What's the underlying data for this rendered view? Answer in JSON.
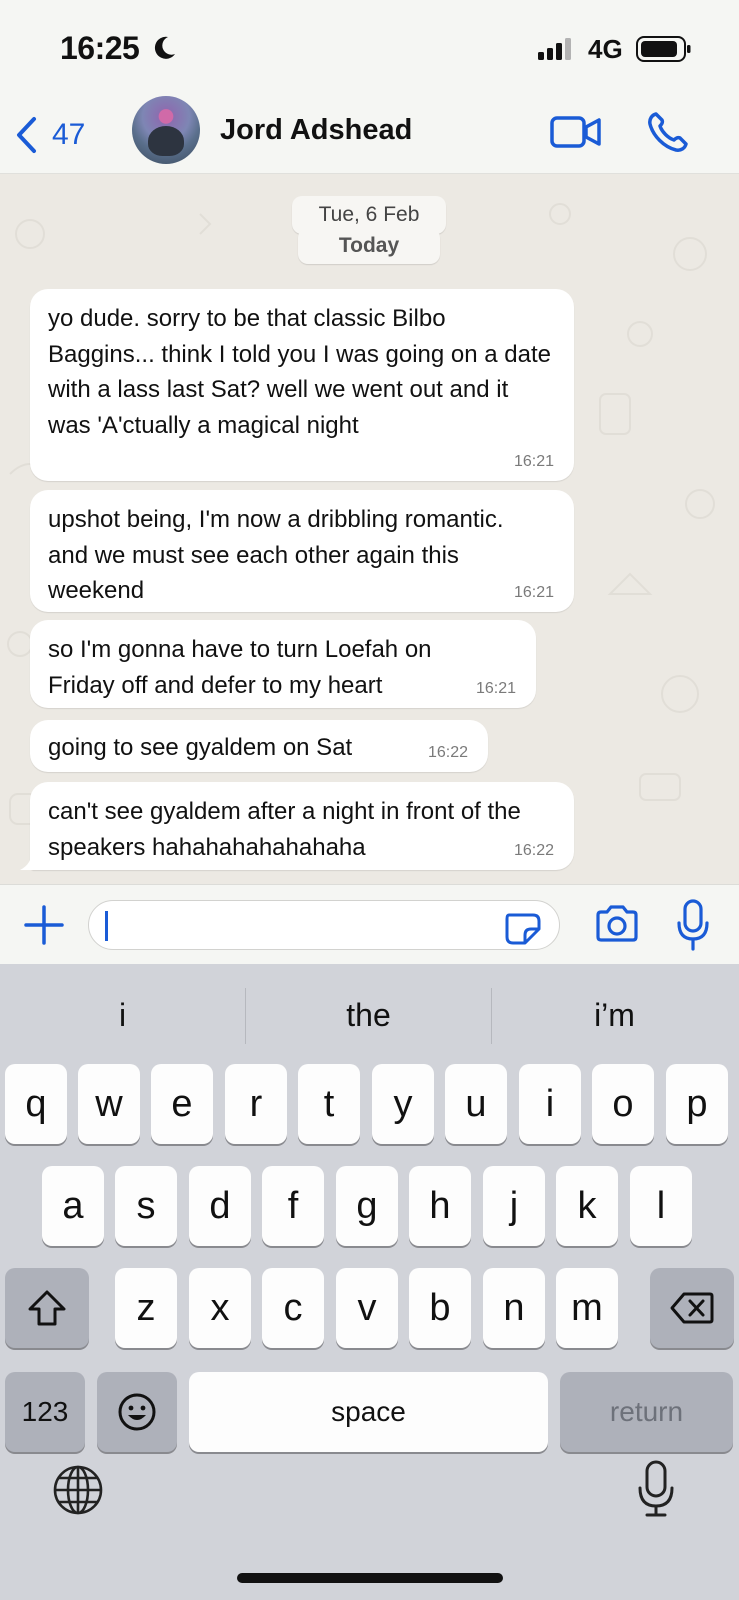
{
  "status_bar": {
    "time": "16:25",
    "network": "4G"
  },
  "header": {
    "back_count": "47",
    "contact_name": "Jord Adshead"
  },
  "chat": {
    "date": "Tue, 6 Feb",
    "today": "Today",
    "messages": [
      {
        "text": "yo dude. sorry to be that classic Bilbo Baggins... think I told you I was going on a date with a lass last Sat? well we went out and it was 'A'ctually a magical night",
        "time": "16:21"
      },
      {
        "text": "upshot being, I'm now a dribbling romantic. and we must see each other again this weekend",
        "time": "16:21"
      },
      {
        "text": "so I'm gonna have to turn Loefah on Friday off and defer to my heart",
        "time": "16:21"
      },
      {
        "text": "going to see gyaldem on Sat",
        "time": "16:22"
      },
      {
        "text": "can't see gyaldem after a night in front of the speakers hahahahahahahaha",
        "time": "16:22"
      }
    ]
  },
  "composer": {
    "value": ""
  },
  "keyboard": {
    "suggestions": [
      "i",
      "the",
      "i’m"
    ],
    "row1": [
      "q",
      "w",
      "e",
      "r",
      "t",
      "y",
      "u",
      "i",
      "o",
      "p"
    ],
    "row2": [
      "a",
      "s",
      "d",
      "f",
      "g",
      "h",
      "j",
      "k",
      "l"
    ],
    "row3": [
      "z",
      "x",
      "c",
      "v",
      "b",
      "n",
      "m"
    ],
    "numbers_key": "123",
    "space_key": "space",
    "return_key": "return"
  },
  "colors": {
    "accent": "#1a5bd6",
    "chat_bg": "#ece9e3",
    "bubble": "#ffffff",
    "keyboard_bg": "#d1d3d9"
  }
}
